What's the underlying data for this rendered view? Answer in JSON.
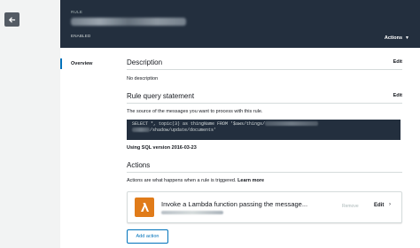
{
  "header": {
    "rule_label": "RULE",
    "status": "ENABLED",
    "actions_label": "Actions"
  },
  "sidebar": {
    "overview": "Overview"
  },
  "description": {
    "title": "Description",
    "edit": "Edit",
    "text": "No description"
  },
  "query": {
    "title": "Rule query statement",
    "edit": "Edit",
    "help": "The source of the messages you want to process with this rule.",
    "line1": "SELECT *, topic(3) as thingName FROM '$aws/things/",
    "line2_end": "/shadow/update/documents'",
    "sql_version": "Using SQL version 2016-03-23"
  },
  "actions": {
    "title": "Actions",
    "help": "Actions are what happens when a rule is triggered.",
    "learn_more": "Learn more",
    "card_title": "Invoke a Lambda function passing the message...",
    "remove": "Remove",
    "edit": "Edit",
    "add_action": "Add action"
  },
  "colors": {
    "header_bg": "#232f3e",
    "accent": "#0073bb",
    "lambda": "#e07b19"
  }
}
